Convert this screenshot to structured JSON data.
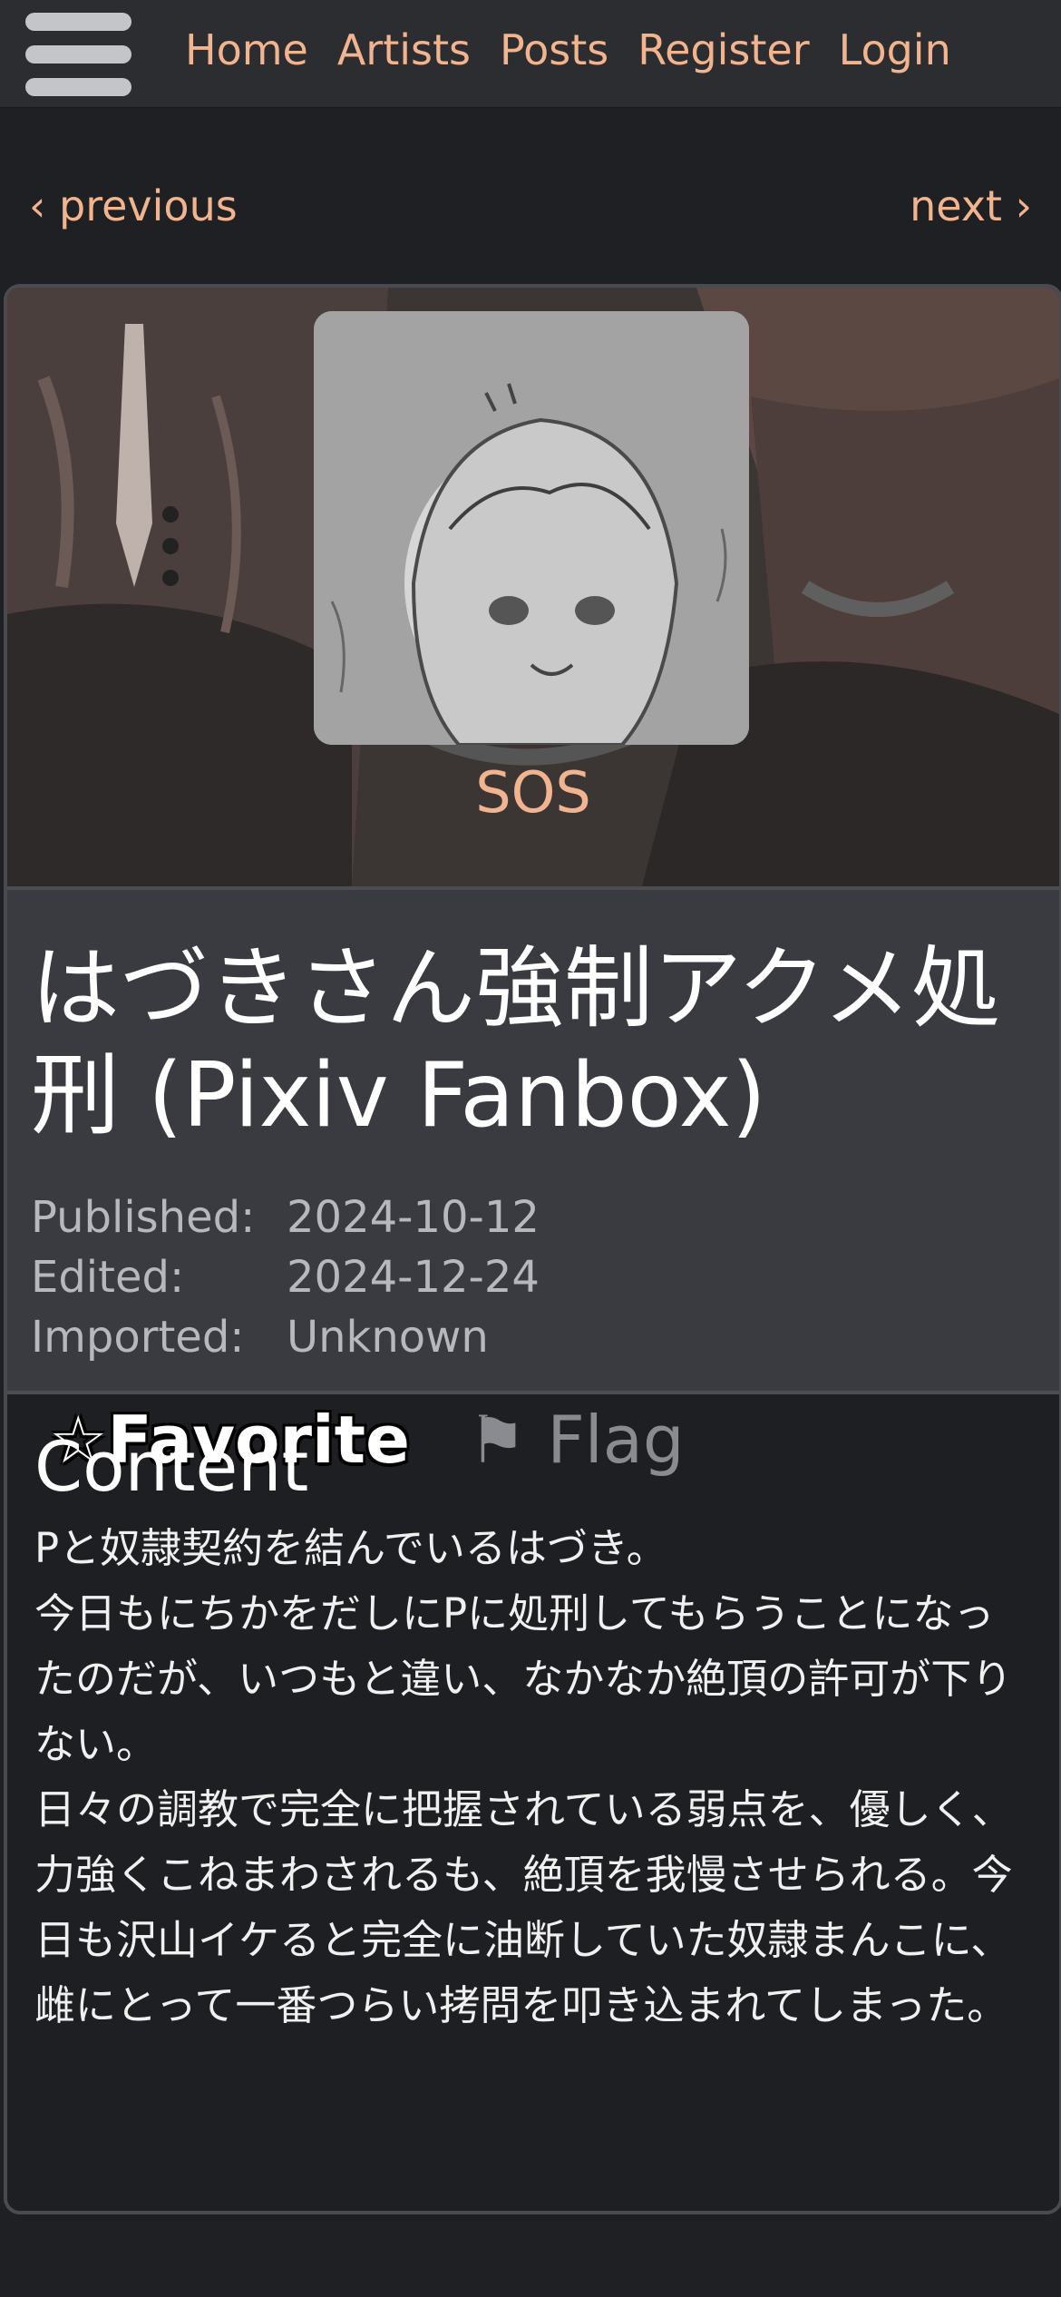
{
  "nav": {
    "links": [
      "Home",
      "Artists",
      "Posts",
      "Register",
      "Login"
    ]
  },
  "pager": {
    "previous": "‹ previous",
    "next": "next ›"
  },
  "artist": {
    "name": "SOS"
  },
  "post": {
    "title": "はづきさん強制アクメ処刑 (Pixiv Fanbox)",
    "dates": [
      {
        "label": "Published:",
        "value": "2024-10-12"
      },
      {
        "label": "Edited:",
        "value": "2024-12-24"
      },
      {
        "label": "Imported:",
        "value": "Unknown"
      }
    ],
    "favorite_label": "☆Favorite",
    "flag_label": "⚑ Flag"
  },
  "content": {
    "heading": "Content",
    "lines": [
      "Pと奴隷契約を結んでいるはづき。",
      "今日もにちかをだしにPに処刑してもらうことになったのだが、いつもと違い、なかなか絶頂の許可が下りない。",
      "日々の調教で完全に把握されている弱点を、優しく、力強くこねまわされるも、絶頂を我慢させられる。今日も沢山イケると完全に油断していた奴隷まんこに、雌にとって一番つらい拷問を叩き込まれてしまった。"
    ]
  },
  "colors": {
    "accent": "#f2b48f",
    "nav_bg": "#2c2d31",
    "meta_bg": "#3a3b41",
    "page_bg": "#1f2023"
  }
}
